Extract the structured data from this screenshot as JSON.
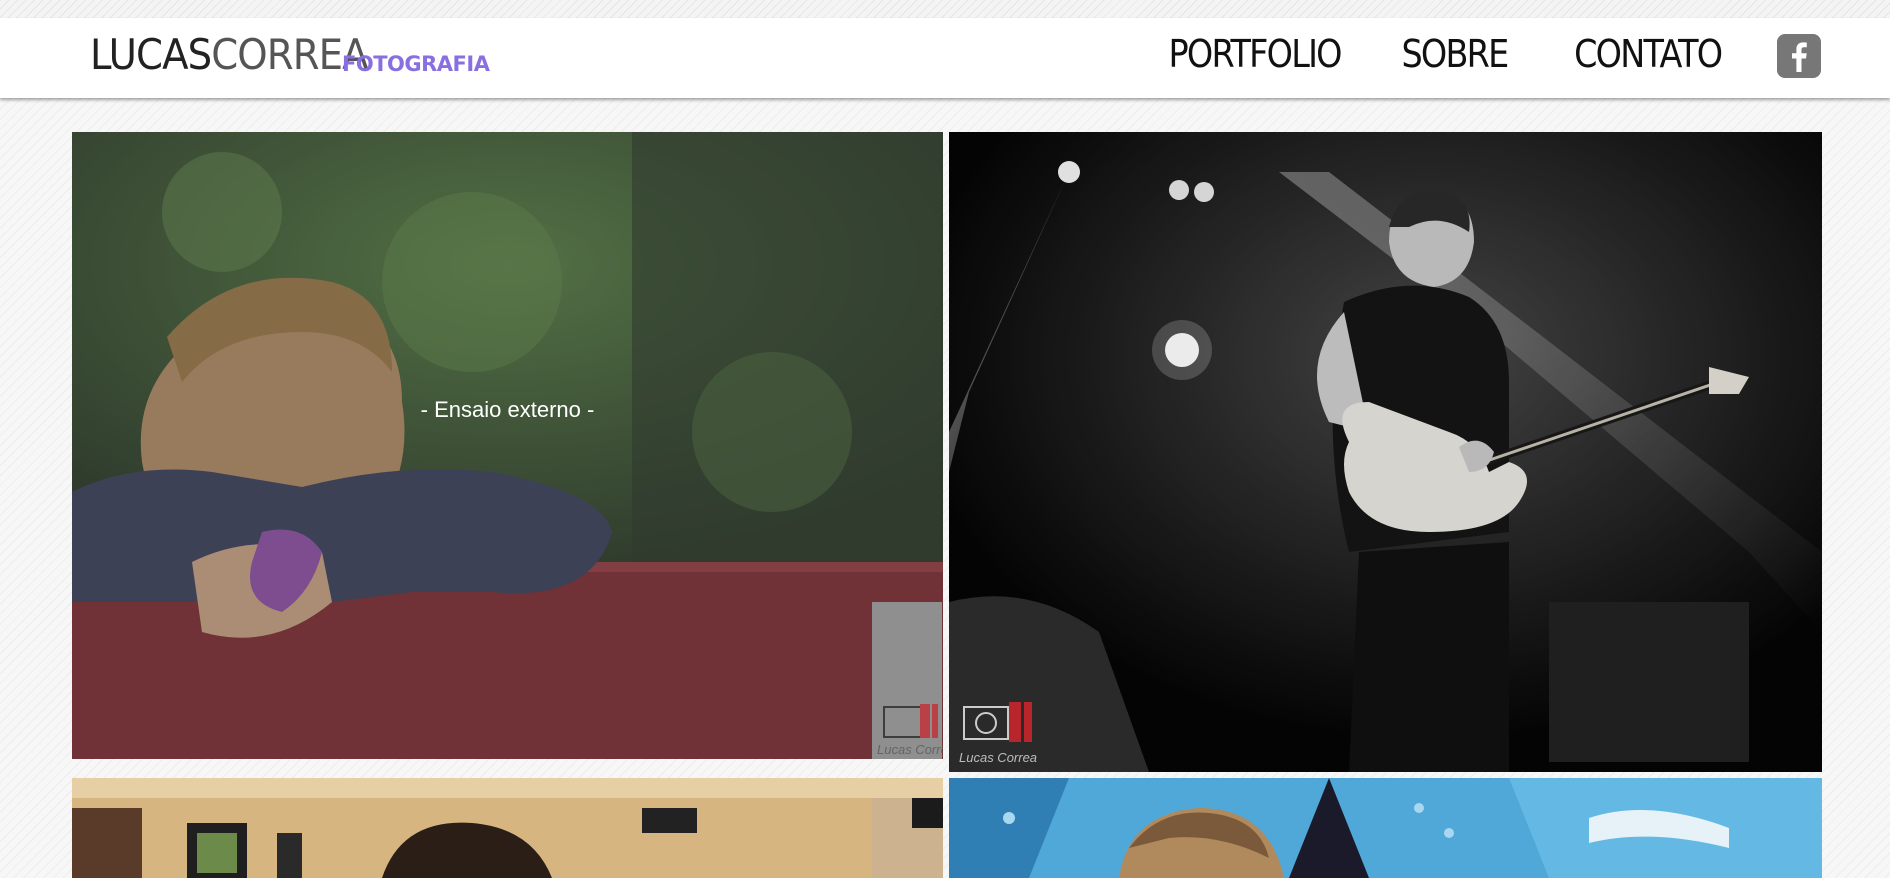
{
  "header": {
    "logo_first": "LUCAS",
    "logo_last": "CORREA",
    "logo_tagline": "FOTOGRAFIA"
  },
  "nav": {
    "items": [
      {
        "label": "PORTFOLIO"
      },
      {
        "label": "SOBRE"
      },
      {
        "label": "CONTATO"
      }
    ],
    "social_icon": "facebook-icon"
  },
  "gallery": {
    "items": [
      {
        "caption": "- Ensaio externo -",
        "hovered": true
      },
      {
        "caption": ""
      },
      {
        "caption": ""
      },
      {
        "caption": ""
      }
    ],
    "watermark": "Lucas Correa"
  },
  "colors": {
    "accent": "#8a6fe0",
    "header_bg": "#ffffff",
    "page_bg": "#f7f7f7",
    "facebook_icon": "#777777",
    "watermark_red": "#c8262c"
  }
}
